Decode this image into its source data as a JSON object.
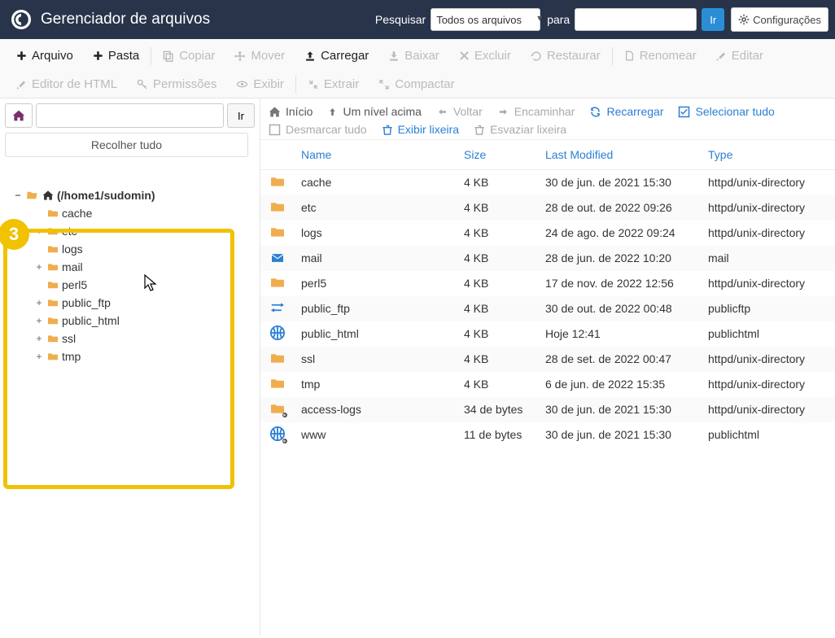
{
  "header": {
    "title": "Gerenciador de arquivos",
    "search_label": "Pesquisar",
    "select_value": "Todos os arquivos",
    "para_label": "para",
    "search_value": "",
    "go_label": "Ir",
    "settings_label": "Configurações"
  },
  "toolbar": {
    "arquivo": "Arquivo",
    "pasta": "Pasta",
    "copiar": "Copiar",
    "mover": "Mover",
    "carregar": "Carregar",
    "baixar": "Baixar",
    "excluir": "Excluir",
    "restaurar": "Restaurar",
    "renomear": "Renomear",
    "editar": "Editar",
    "editor_html": "Editor de HTML",
    "permissoes": "Permissões",
    "exibir": "Exibir",
    "extrair": "Extrair",
    "compactar": "Compactar"
  },
  "sidebar": {
    "path_value": "",
    "go_label": "Ir",
    "collapse_label": "Recolher tudo",
    "badge": "3",
    "root_label": "(/home1/sudomin)",
    "nodes": {
      "cache": "cache",
      "etc": "etc",
      "logs": "logs",
      "mail": "mail",
      "perl5": "perl5",
      "public_ftp": "public_ftp",
      "public_html": "public_html",
      "ssl": "ssl",
      "tmp": "tmp"
    }
  },
  "content_toolbar": {
    "inicio": "Início",
    "nivel_acima": "Um nível acima",
    "voltar": "Voltar",
    "encaminhar": "Encaminhar",
    "recarregar": "Recarregar",
    "selecionar_tudo": "Selecionar tudo",
    "desmarcar_tudo": "Desmarcar tudo",
    "exibir_lixeira": "Exibir lixeira",
    "esvaziar_lixeira": "Esvaziar lixeira"
  },
  "table": {
    "headers": {
      "name": "Name",
      "size": "Size",
      "modified": "Last Modified",
      "type": "Type"
    },
    "rows": [
      {
        "icon": "folder",
        "name": "cache",
        "size": "4 KB",
        "mod": "30 de jun. de 2021 15:30",
        "type": "httpd/unix-directory"
      },
      {
        "icon": "folder",
        "name": "etc",
        "size": "4 KB",
        "mod": "28 de out. de 2022 09:26",
        "type": "httpd/unix-directory"
      },
      {
        "icon": "folder",
        "name": "logs",
        "size": "4 KB",
        "mod": "24 de ago. de 2022 09:24",
        "type": "httpd/unix-directory"
      },
      {
        "icon": "mail",
        "name": "mail",
        "size": "4 KB",
        "mod": "28 de jun. de 2022 10:20",
        "type": "mail"
      },
      {
        "icon": "folder",
        "name": "perl5",
        "size": "4 KB",
        "mod": "17 de nov. de 2022 12:56",
        "type": "httpd/unix-directory"
      },
      {
        "icon": "ftp",
        "name": "public_ftp",
        "size": "4 KB",
        "mod": "30 de out. de 2022 00:48",
        "type": "publicftp"
      },
      {
        "icon": "globe",
        "name": "public_html",
        "size": "4 KB",
        "mod": "Hoje 12:41",
        "type": "publichtml"
      },
      {
        "icon": "folder",
        "name": "ssl",
        "size": "4 KB",
        "mod": "28 de set. de 2022 00:47",
        "type": "httpd/unix-directory"
      },
      {
        "icon": "folder",
        "name": "tmp",
        "size": "4 KB",
        "mod": "6 de jun. de 2022 15:35",
        "type": "httpd/unix-directory"
      },
      {
        "icon": "folder-link",
        "name": "access-logs",
        "size": "34 de bytes",
        "mod": "30 de jun. de 2021 15:30",
        "type": "httpd/unix-directory"
      },
      {
        "icon": "globe-link",
        "name": "www",
        "size": "11 de bytes",
        "mod": "30 de jun. de 2021 15:30",
        "type": "publichtml"
      }
    ]
  }
}
